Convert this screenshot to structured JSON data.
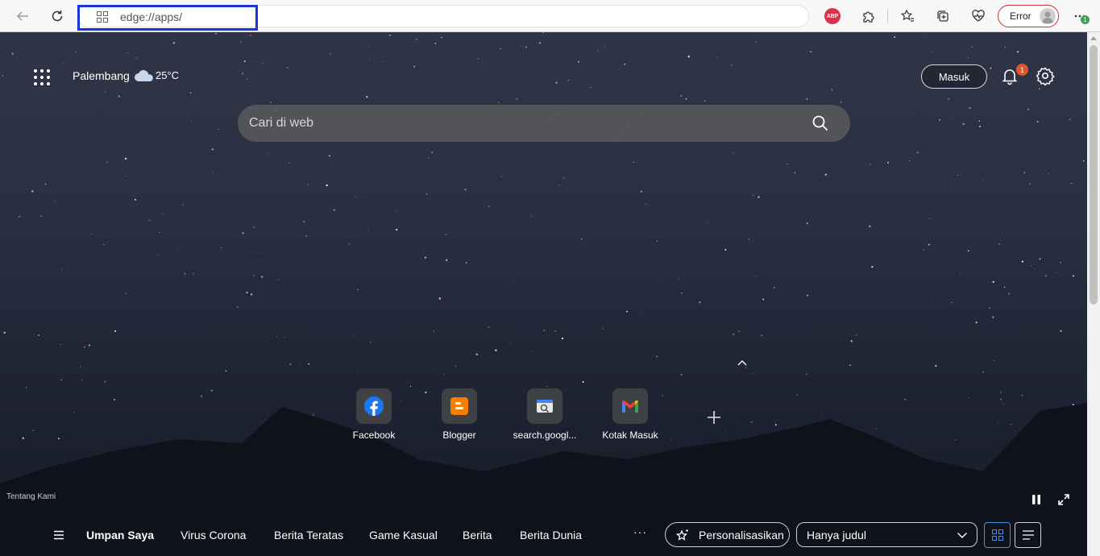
{
  "toolbar": {
    "address": "edge://apps/",
    "profile_label": "Error",
    "abp_label": "ABP",
    "notification_dot": "1"
  },
  "ntp": {
    "weather": {
      "city": "Palembang",
      "temp": "25°C",
      "icon": "cloud-icon"
    },
    "signin_label": "Masuk",
    "notification_count": "1",
    "search_placeholder": "Cari di web",
    "tiles": [
      {
        "label": "Facebook",
        "icon": "facebook-icon",
        "color": "#1877f2"
      },
      {
        "label": "Blogger",
        "icon": "blogger-icon",
        "color": "#f57d00"
      },
      {
        "label": "search.googl...",
        "icon": "search-console-icon",
        "color": "#4285f4"
      },
      {
        "label": "Kotak Masuk",
        "icon": "gmail-icon",
        "color": "#ea4335"
      }
    ],
    "footer_link": "Tentang Kami"
  },
  "feed": {
    "tabs": [
      "Umpan Saya",
      "Virus Corona",
      "Berita Teratas",
      "Game Kasual",
      "Berita",
      "Berita Dunia"
    ],
    "more": "···",
    "personalize_label": "Personalisasikan",
    "view_option": "Hanya judul"
  }
}
